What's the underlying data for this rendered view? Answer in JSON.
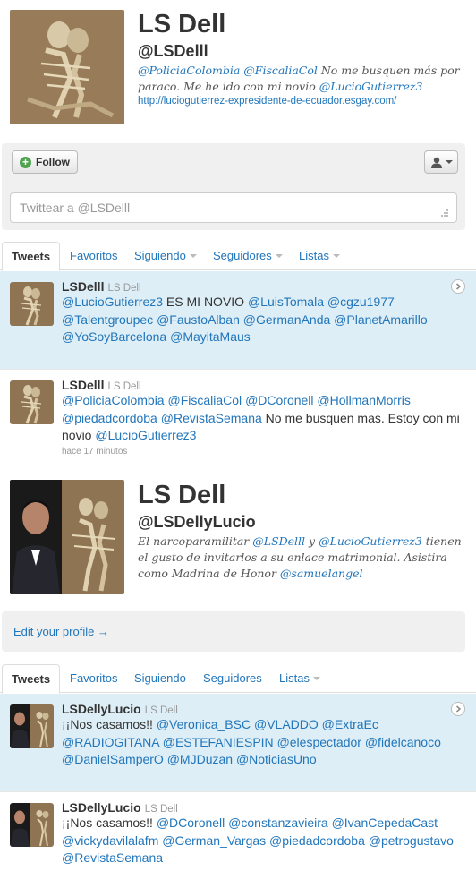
{
  "profile1": {
    "name": "LS Dell",
    "handle": "@LSDelll",
    "bio_mention1": "@PoliciaColombia",
    "bio_mention2": "@FiscaliaCol",
    "bio_text1": " No me busquen más por paraco. Me he ido con mi novio ",
    "bio_mention3": "@LucioGutierrez3",
    "url": "http://luciogutierrez-expresidente-de-ecuador.esgay.com/"
  },
  "actions": {
    "follow_label": "Follow",
    "tweet_placeholder": "Twittear a @LSDelll"
  },
  "tabs1": [
    {
      "label": "Tweets"
    },
    {
      "label": "Favoritos"
    },
    {
      "label": "Siguiendo"
    },
    {
      "label": "Seguidores"
    },
    {
      "label": "Listas"
    }
  ],
  "tweets1": [
    {
      "user": "LSDelll",
      "full": "LS Dell",
      "parts": [
        "@LucioGutierrez3",
        " ES MI NOVIO ",
        "@LuisTomala",
        " ",
        "@cgzu1977",
        " ",
        "@Talentgroupec",
        " ",
        "@FaustoAlban",
        " ",
        "@GermanAnda",
        " ",
        "@PlanetAmarillo",
        " ",
        "@YoSoyBarcelona",
        " ",
        "@MayitaMaus"
      ]
    },
    {
      "user": "LSDelll",
      "full": "LS Dell",
      "parts": [
        "@PoliciaColombia",
        " ",
        "@FiscaliaCol",
        " ",
        "@DCoronell",
        " ",
        "@HollmanMorris",
        " ",
        "@piedadcordoba",
        " ",
        "@RevistaSemana",
        " No me busquen mas. Estoy con mi novio ",
        "@LucioGutierrez3"
      ],
      "time": "hace 17 minutos"
    }
  ],
  "profile2": {
    "name": "LS Dell",
    "handle": "@LSDellyLucio",
    "bio_text1": "El narcoparamilitar ",
    "bio_mention1": "@LSDelll",
    "bio_text2": " y ",
    "bio_mention2": "@LucioGutierrez3",
    "bio_text3": " tienen el gusto de invitarlos a su enlace matrimonial. Asistira como Madrina de Honor ",
    "bio_mention3": "@samuelangel",
    "edit_label": "Edit your profile →"
  },
  "tabs2": [
    {
      "label": "Tweets"
    },
    {
      "label": "Favoritos"
    },
    {
      "label": "Siguiendo"
    },
    {
      "label": "Seguidores"
    },
    {
      "label": "Listas"
    }
  ],
  "tweets2": [
    {
      "user": "LSDellyLucio",
      "full": "LS Dell",
      "parts": [
        "¡¡Nos casamos!! ",
        "@Veronica_BSC",
        " ",
        "@VLADDO",
        " ",
        "@ExtraEc",
        " ",
        "@RADIOGITANA",
        " ",
        "@ESTEFANIESPIN",
        " ",
        "@elespectador",
        " ",
        "@fidelcanoco",
        " ",
        "@DanielSamperO",
        " ",
        "@MJDuzan",
        " ",
        "@NoticiasUno"
      ]
    },
    {
      "user": "LSDellyLucio",
      "full": "LS Dell",
      "parts": [
        "¡¡Nos casamos!! ",
        "@DCoronell",
        " ",
        "@constanzavieira",
        " ",
        "@IvanCepedaCast",
        " ",
        "@vickydavilalafm",
        " ",
        "@German_Vargas",
        " ",
        "@piedadcordoba",
        " ",
        "@petrogustavo",
        " ",
        "@RevistaSemana"
      ]
    }
  ],
  "colors": {
    "link": "#2276bb",
    "highlight": "#ddeef6",
    "panel": "#f0f0f0"
  }
}
